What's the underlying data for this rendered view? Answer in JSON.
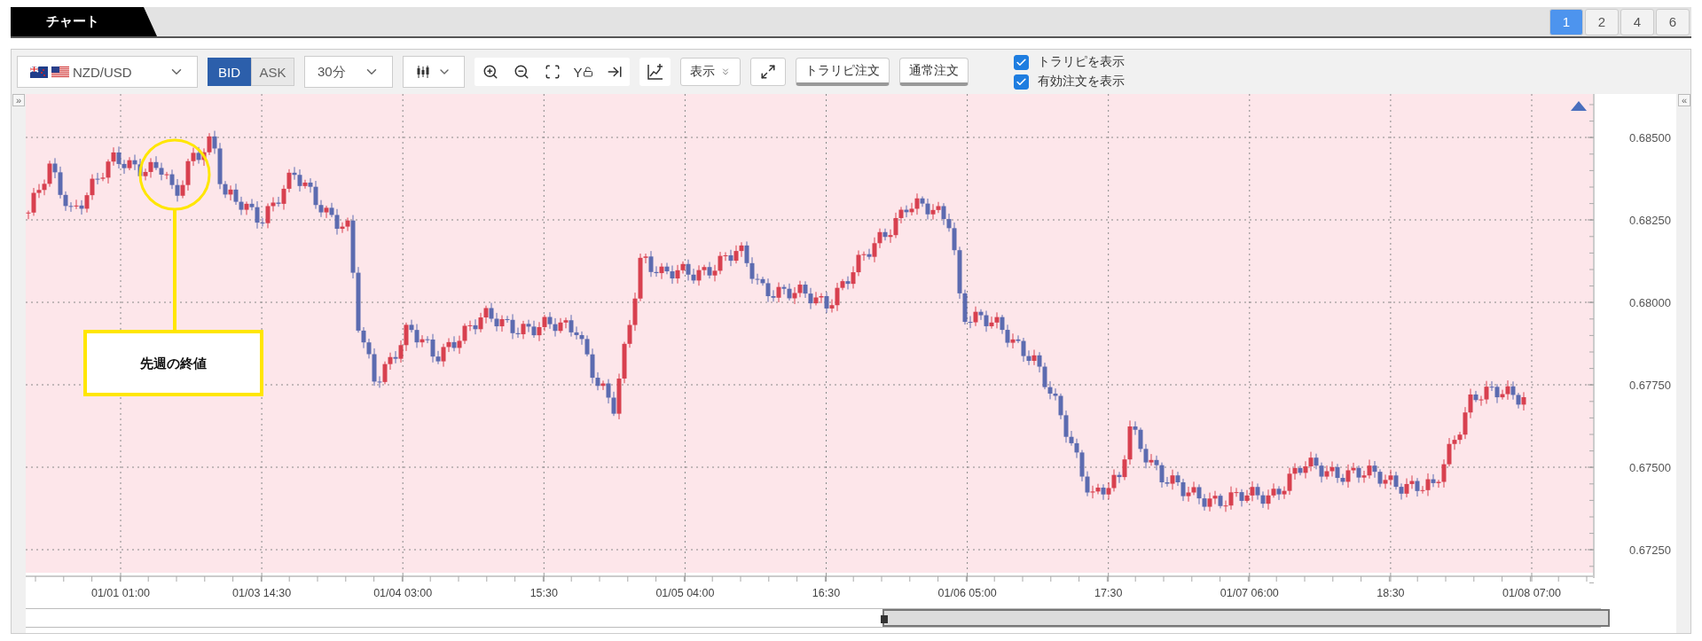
{
  "tab_bar": {
    "title": "チャート",
    "layouts": [
      {
        "label": "1",
        "selected": true
      },
      {
        "label": "2",
        "selected": false
      },
      {
        "label": "4",
        "selected": false
      },
      {
        "label": "6",
        "selected": false
      }
    ]
  },
  "toolbar": {
    "pair": "NZD/USD",
    "price_types": [
      {
        "label": "BID",
        "selected": true
      },
      {
        "label": "ASK",
        "selected": false
      }
    ],
    "timeframe": "30分",
    "y_lock_label": "Y",
    "display_menu": "表示",
    "order_buttons": [
      "トラリピ注文",
      "通常注文"
    ],
    "options": [
      {
        "label": "トラリピを表示",
        "checked": true
      },
      {
        "label": "有効注文を表示",
        "checked": true
      }
    ]
  },
  "chart": {
    "left_toggle": "»",
    "right_toggle": "«",
    "annotation": "先週の終値",
    "price_axis": [
      "0.68500",
      "0.68250",
      "0.68000",
      "0.67750",
      "0.67500",
      "0.67250"
    ],
    "time_axis": [
      "01/01 01:00",
      "01/03 14:30",
      "01/04 03:00",
      "15:30",
      "01/05 04:00",
      "16:30",
      "01/06 05:00",
      "17:30",
      "01/07 06:00",
      "18:30",
      "01/08 07:00"
    ]
  }
}
